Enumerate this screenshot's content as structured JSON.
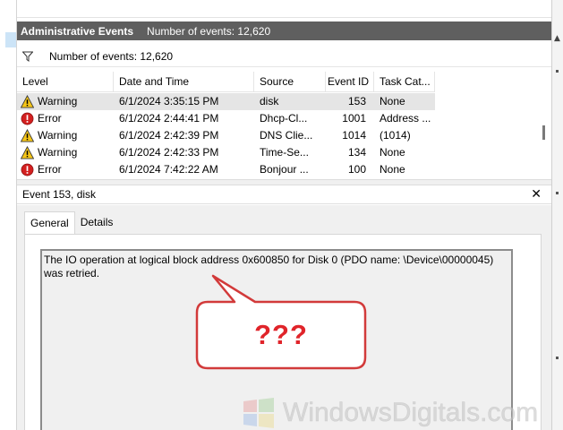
{
  "header": {
    "title": "Administrative Events",
    "event_count": "Number of events: 12,620"
  },
  "filter": {
    "icon": "filter-icon",
    "count": "Number of events: 12,620"
  },
  "events_table": {
    "columns": [
      "Level",
      "Date and Time",
      "Source",
      "Event ID",
      "Task Cat..."
    ],
    "rows": [
      {
        "level": "Warning",
        "datetime": "6/1/2024 3:35:15 PM",
        "source": "disk",
        "event_id": "153",
        "task": "None"
      },
      {
        "level": "Error",
        "datetime": "6/1/2024 2:44:41 PM",
        "source": "Dhcp-Cl...",
        "event_id": "1001",
        "task": "Address ..."
      },
      {
        "level": "Warning",
        "datetime": "6/1/2024 2:42:39 PM",
        "source": "DNS Clie...",
        "event_id": "1014",
        "task": "(1014)"
      },
      {
        "level": "Warning",
        "datetime": "6/1/2024 2:42:33 PM",
        "source": "Time-Se...",
        "event_id": "134",
        "task": "None"
      },
      {
        "level": "Error",
        "datetime": "6/1/2024 7:42:22 AM",
        "source": "Bonjour ...",
        "event_id": "100",
        "task": "None"
      }
    ]
  },
  "detail": {
    "title": "Event 153, disk",
    "close_icon": "close-icon",
    "tabs": [
      "General",
      "Details"
    ],
    "active_tab": "General",
    "description": "The IO operation at logical block address 0x600850 for Disk 0 (PDO name: \\Device\\00000045) was retried."
  },
  "annotation": {
    "text": "???"
  },
  "watermark": {
    "text": "WindowsDigitals.com"
  },
  "colors": {
    "title_bar": "#5f5f5f",
    "selected_row": "#e5e5e5",
    "callout_text": "#e0242a",
    "callout_border": "#d23a3a",
    "warning": "#f5c518",
    "error": "#d32020"
  }
}
